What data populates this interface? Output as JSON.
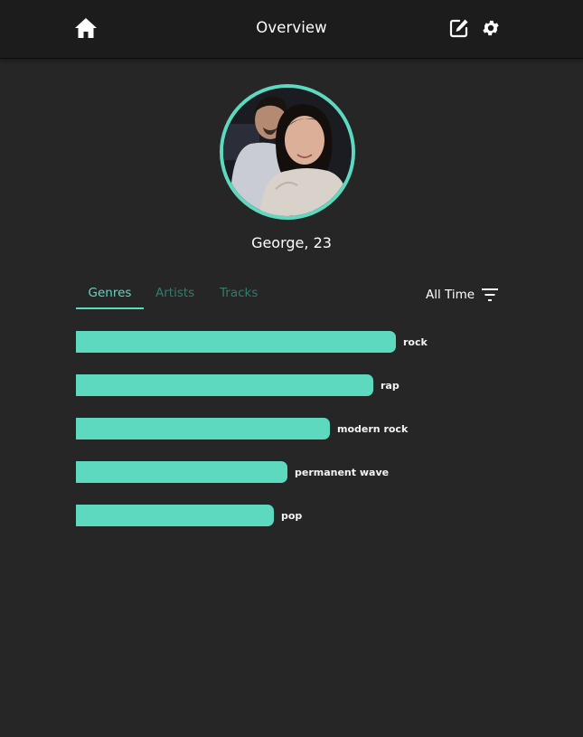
{
  "header": {
    "title": "Overview",
    "home_icon": "home-icon",
    "edit_icon": "edit-icon",
    "settings_icon": "gear-icon"
  },
  "profile": {
    "name_age": "George, 23",
    "avatar_ring_color": "#5dd9bf"
  },
  "tabs": [
    {
      "label": "Genres",
      "active": true
    },
    {
      "label": "Artists",
      "active": false
    },
    {
      "label": "Tracks",
      "active": false
    }
  ],
  "time_filter": {
    "label": "All Time",
    "icon": "filter-icon"
  },
  "genres": [
    {
      "label": "rock",
      "value": 1.0
    },
    {
      "label": "rap",
      "value": 0.93
    },
    {
      "label": "modern rock",
      "value": 0.795
    },
    {
      "label": "permanent wave",
      "value": 0.66
    },
    {
      "label": "pop",
      "value": 0.62
    }
  ],
  "colors": {
    "accent": "#5dd9bf",
    "accent_muted": "#2f7e6c",
    "background": "#262626",
    "header": "#1c1c1c"
  }
}
